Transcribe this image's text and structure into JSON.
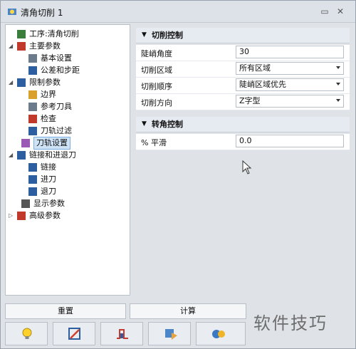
{
  "window": {
    "title": "清角切削 1"
  },
  "tree": [
    {
      "label": "工序:清角切削",
      "icon": "operation-icon",
      "expander": ""
    },
    {
      "label": "主要参数",
      "icon": "main-params-icon",
      "expander": "◢"
    },
    {
      "label": "基本设置",
      "icon": "basic-settings-icon",
      "expander": ""
    },
    {
      "label": "公差和步距",
      "icon": "tolerance-step-icon",
      "expander": ""
    },
    {
      "label": "限制参数",
      "icon": "limit-params-icon",
      "expander": "◢"
    },
    {
      "label": "边界",
      "icon": "boundary-icon",
      "expander": ""
    },
    {
      "label": "参考刀具",
      "icon": "reference-tool-icon",
      "expander": ""
    },
    {
      "label": "检查",
      "icon": "check-icon",
      "expander": ""
    },
    {
      "label": "刀轨过滤",
      "icon": "toolpath-filter-icon",
      "expander": ""
    },
    {
      "label": "刀轨设置",
      "icon": "toolpath-settings-icon",
      "expander": "",
      "selected": true
    },
    {
      "label": "链接和进退刀",
      "icon": "link-lead-icon",
      "expander": "◢"
    },
    {
      "label": "链接",
      "icon": "link-icon",
      "expander": ""
    },
    {
      "label": "进刀",
      "icon": "lead-in-icon",
      "expander": ""
    },
    {
      "label": "退刀",
      "icon": "lead-out-icon",
      "expander": ""
    },
    {
      "label": "显示参数",
      "icon": "display-params-icon",
      "expander": ""
    },
    {
      "label": "高级参数",
      "icon": "advanced-params-icon",
      "expander": "▷"
    }
  ],
  "cut_control": {
    "header": "切削控制",
    "rows": [
      {
        "label": "陡峭角度",
        "value": "30",
        "dropdown": false
      },
      {
        "label": "切削区域",
        "value": "所有区域",
        "dropdown": true
      },
      {
        "label": "切削顺序",
        "value": "陡峭区域优先",
        "dropdown": true
      },
      {
        "label": "切削方向",
        "value": "Z字型",
        "dropdown": true
      }
    ]
  },
  "corner_control": {
    "header": "转角控制",
    "rows": [
      {
        "label": "% 平滑",
        "value": "0.0",
        "dropdown": false
      }
    ]
  },
  "buttons": {
    "reset": "重置",
    "compute": "计算"
  },
  "icon_toolbar": [
    "tip-bulb-icon",
    "edit-icon",
    "pulse-icon",
    "tool-icon",
    "gear-settings-icon"
  ],
  "watermark": "软件技巧",
  "colors": {
    "selection": "#cfe3f7",
    "accent": "#2b6cb0"
  }
}
